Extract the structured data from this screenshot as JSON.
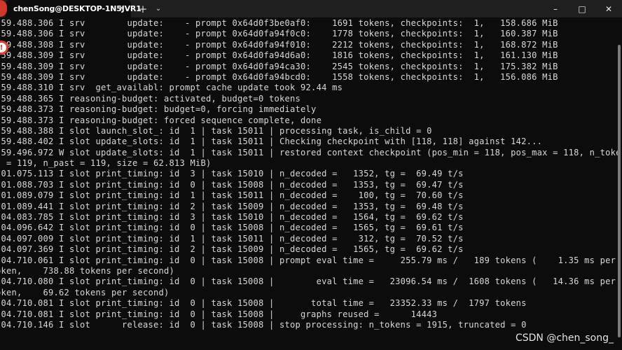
{
  "window": {
    "tab_title": "chenSong@DESKTOP-1N5JVR1",
    "tab_close_glyph": "✕",
    "new_tab_glyph": "+",
    "dropdown_glyph": "⌄",
    "minimize_glyph": "–",
    "maximize_glyph": "□",
    "close_glyph": "✕",
    "icons": [
      "close-icon",
      "plus-icon",
      "chevron-down-icon",
      "minimize-icon",
      "maximize-icon",
      "close-icon"
    ]
  },
  "terminal": {
    "lines": [
      ".59.488.306 I srv        update:    - prompt 0x64d0f3be0af0:    1691 tokens, checkpoints:  1,   158.686 MiB",
      ".59.488.306 I srv        update:    - prompt 0x64d0fa94f0c0:    1778 tokens, checkpoints:  1,   160.387 MiB",
      ".59.488.308 I srv        update:    - prompt 0x64d0fa94f010:    2212 tokens, checkpoints:  1,   168.872 MiB",
      ".59.488.309 I srv        update:    - prompt 0x64d0fa94d6a0:    1816 tokens, checkpoints:  1,   161.130 MiB",
      ".59.488.309 I srv        update:    - prompt 0x64d0fa94ca30:    2545 tokens, checkpoints:  1,   175.382 MiB",
      ".59.488.309 I srv        update:    - prompt 0x64d0fa94bcd0:    1558 tokens, checkpoints:  1,   156.086 MiB",
      ".59.488.310 I srv  get_availabl: prompt cache update took 92.44 ms",
      ".59.488.365 I reasoning-budget: activated, budget=0 tokens",
      ".59.488.373 I reasoning-budget: budget=0, forcing immediately",
      ".59.488.373 I reasoning-budget: forced sequence complete, done",
      ".59.488.388 I slot launch_slot_: id  1 | task 15011 | processing task, is_child = 0",
      ".59.488.402 I slot update_slots: id  1 | task 15011 | Checking checkpoint with [118, 118] against 142...",
      ".59.496.972 W slot update_slots: id  1 | task 15011 | restored context checkpoint (pos_min = 118, pos_max = 118, n_toke",
      "s = 119, n_past = 119, size = 62.813 MiB)",
      ".01.075.113 I slot print_timing: id  3 | task 15010 | n_decoded =   1352, tg =  69.49 t/s",
      ".01.088.703 I slot print_timing: id  0 | task 15008 | n_decoded =   1353, tg =  69.47 t/s",
      ".01.089.079 I slot print_timing: id  1 | task 15011 | n_decoded =    100, tg =  70.60 t/s",
      ".01.089.441 I slot print_timing: id  2 | task 15009 | n_decoded =   1353, tg =  69.48 t/s",
      ".04.083.785 I slot print_timing: id  3 | task 15010 | n_decoded =   1564, tg =  69.62 t/s",
      ".04.096.642 I slot print_timing: id  0 | task 15008 | n_decoded =   1565, tg =  69.61 t/s",
      ".04.097.009 I slot print_timing: id  1 | task 15011 | n_decoded =    312, tg =  70.52 t/s",
      ".04.097.369 I slot print_timing: id  2 | task 15009 | n_decoded =   1565, tg =  69.62 t/s",
      ".04.710.061 I slot print_timing: id  0 | task 15008 | prompt eval time =     255.79 ms /   189 tokens (    1.35 ms per",
      "oken,    738.88 tokens per second)",
      ".04.710.080 I slot print_timing: id  0 | task 15008 |        eval time =   23096.54 ms /  1608 tokens (   14.36 ms per",
      "oken,    69.62 tokens per second)",
      ".04.710.081 I slot print_timing: id  0 | task 15008 |       total time =   23352.33 ms /  1797 tokens",
      ".04.710.081 I slot print_timing: id  0 | task 15008 |     graphs reused =      14443",
      ".04.710.146 I slot      release: id  0 | task 15008 | stop processing: n_tokens = 1915, truncated = 0"
    ]
  },
  "notification": {
    "glyph": "!"
  },
  "watermark": {
    "text": "CSDN @chen_song_"
  }
}
